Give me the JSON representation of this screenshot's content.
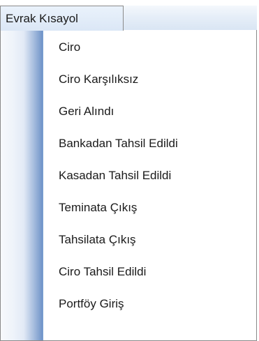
{
  "menu": {
    "title": "Evrak Kısayol",
    "items": [
      {
        "label": "Ciro"
      },
      {
        "label": "Ciro Karşılıksız"
      },
      {
        "label": "Geri Alındı"
      },
      {
        "label": "Bankadan Tahsil Edildi"
      },
      {
        "label": "Kasadan Tahsil Edildi"
      },
      {
        "label": "Teminata Çıkış"
      },
      {
        "label": "Tahsilata Çıkış"
      },
      {
        "label": "Ciro Tahsil Edildi"
      },
      {
        "label": "Portföy Giriş"
      }
    ]
  },
  "colors": {
    "menubar": "#dbe7f6",
    "gutter_accent": "#6f93c8",
    "border": "#8a8a8a",
    "text": "#1a1a1a"
  }
}
